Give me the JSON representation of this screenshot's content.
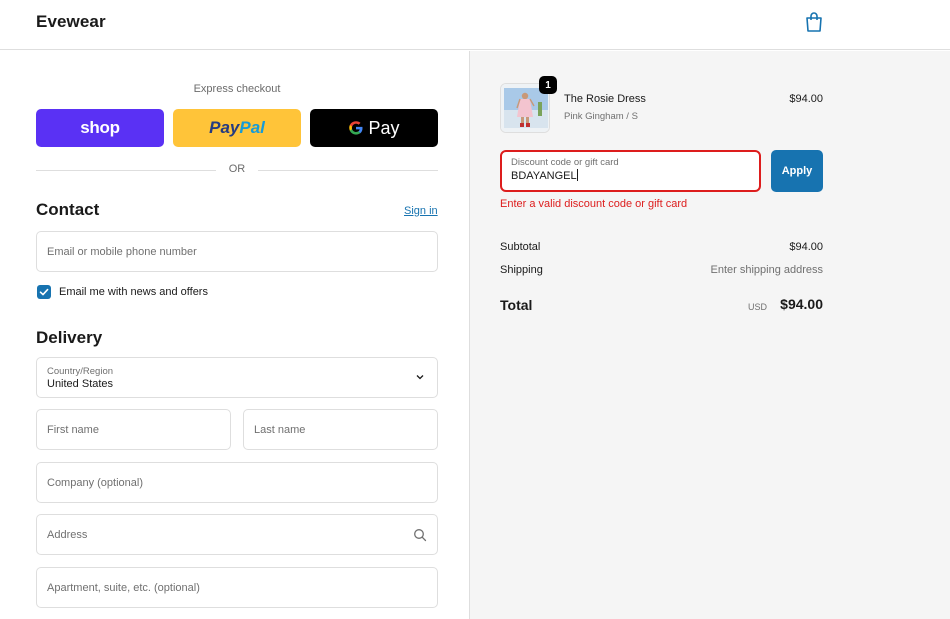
{
  "header": {
    "brand": "Evewear",
    "bag_icon": "shopping-bag-icon"
  },
  "express": {
    "label": "Express checkout",
    "shop_label": "shop",
    "paypal_a": "Pay",
    "paypal_b": "Pal",
    "gpay_g": "G",
    "gpay_label": "Pay",
    "or_label": "OR"
  },
  "contact": {
    "title": "Contact",
    "signin": "Sign in",
    "email_placeholder": "Email or mobile phone number",
    "newsletter_label": "Email me with news and offers",
    "newsletter_checked": true
  },
  "delivery": {
    "title": "Delivery",
    "country_label": "Country/Region",
    "country_value": "United States",
    "first_name_placeholder": "First name",
    "last_name_placeholder": "Last name",
    "company_placeholder": "Company (optional)",
    "address_placeholder": "Address",
    "apartment_placeholder": "Apartment, suite, etc. (optional)"
  },
  "order": {
    "quantity": "1",
    "product_name": "The Rosie Dress",
    "variant": "Pink Gingham / S",
    "price": "$94.00",
    "discount_label": "Discount code or gift card",
    "discount_value": "BDAYANGEL",
    "apply_label": "Apply",
    "error": "Enter a valid discount code or gift card",
    "subtotal_label": "Subtotal",
    "subtotal_value": "$94.00",
    "shipping_label": "Shipping",
    "shipping_value": "Enter shipping address",
    "total_label": "Total",
    "total_currency": "USD",
    "total_value": "$94.00"
  },
  "colors": {
    "accent": "#1773b0",
    "error": "#dd1d1d",
    "shop_purple": "#5a31f4",
    "paypal_yellow": "#ffc439"
  }
}
